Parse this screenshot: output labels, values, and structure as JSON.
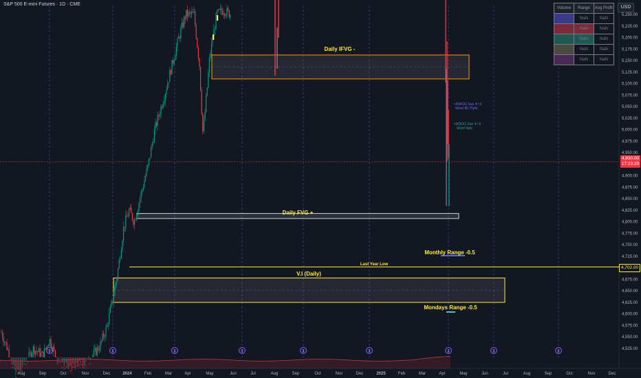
{
  "header": {
    "title": "S&P 500 E-mini Futures · 1D · CME",
    "currency": "USD"
  },
  "colors": {
    "background": "#131722",
    "up_candle": "#089981",
    "down_candle": "#f23645",
    "zone_orange": "#ff9800",
    "zone_yellow": "#ffeb3b",
    "zone_white": "#d1d4dc",
    "grid_dashed": "#4a4f9e",
    "current_price": "#f23645"
  },
  "price_axis": {
    "ticks": [
      "5,250.00",
      "5,225.00",
      "5,200.00",
      "5,175.00",
      "5,150.00",
      "5,125.00",
      "5,100.00",
      "5,075.00",
      "5,050.00",
      "5,025.00",
      "5,000.00",
      "4,975.00",
      "4,950.00",
      "4,925.00",
      "4,900.00",
      "4,875.00",
      "4,850.00",
      "4,825.00",
      "4,800.00",
      "4,775.00",
      "4,750.00",
      "4,725.00",
      "4,700.00",
      "4,675.00",
      "4,650.00",
      "4,625.00",
      "4,600.00",
      "4,575.00",
      "4,550.00",
      "4,525.00"
    ],
    "current_price_label": "4,930.00",
    "current_time_label": "17:23:29",
    "marker_label": "4,702.00"
  },
  "time_axis": {
    "labels": [
      "Aug",
      "Sep",
      "Oct",
      "Nov",
      "Dec",
      "2024",
      "Feb",
      "Mar",
      "Apr",
      "May",
      "Jun",
      "Jul",
      "Aug",
      "Sep",
      "Oct",
      "Nov",
      "Dec",
      "2025",
      "Feb",
      "Mar",
      "Apr",
      "May",
      "Jun",
      "Jul",
      "Aug",
      "Sep",
      "Oct",
      "Nov",
      "Dec"
    ],
    "bold": [
      "2024",
      "2025"
    ]
  },
  "annotations": {
    "daily_ifvg": "Daily IFVG -",
    "daily_fvg": "Daily FVG +",
    "monthly_range": "Monthly Range -0.5",
    "last_year_low": "Last Year Low",
    "vi_daily": "V.I (Daily)",
    "mondays_range": "Mondays Range -0.5",
    "note_1_line1": "<NWOG Sun 4 / 6",
    "note_1_line2": "Short 86.75pts",
    "note_2_line1": "<NDOG Sun 4 / 6",
    "note_2_line2": "Short 0pts"
  },
  "range_table": {
    "headers": [
      "Volume",
      "Range",
      "Avg Profit"
    ],
    "rows": [
      [
        "",
        "NaN",
        "NaN"
      ],
      [
        "",
        "NaN",
        "NaN"
      ],
      [
        "",
        "NaN",
        "NaN"
      ],
      [
        "",
        "NaN",
        "NaN"
      ],
      [
        "",
        "NaN",
        "NaN"
      ]
    ],
    "row_colors": [
      "#3a3a8a",
      "#7a2a3a",
      "#1f5a52",
      "#4a4a40",
      "#4a2a55"
    ]
  },
  "chart_data": {
    "type": "candlestick",
    "symbol": "S&P 500 E-mini Futures",
    "timeframe": "1D",
    "y_range": [
      4515,
      5270
    ],
    "current_price": 4930,
    "zones": [
      {
        "name": "Daily IFVG -",
        "low": 5110,
        "high": 5162,
        "color": "#ff9800"
      },
      {
        "name": "Daily FVG +",
        "low": 4807,
        "high": 4818,
        "color": "#d1d4dc"
      },
      {
        "name": "V.I (Daily)",
        "low": 4625,
        "high": 4678,
        "color": "#ffeb3b"
      }
    ],
    "levels": [
      {
        "name": "Last Year Low",
        "value": 4702
      }
    ]
  }
}
